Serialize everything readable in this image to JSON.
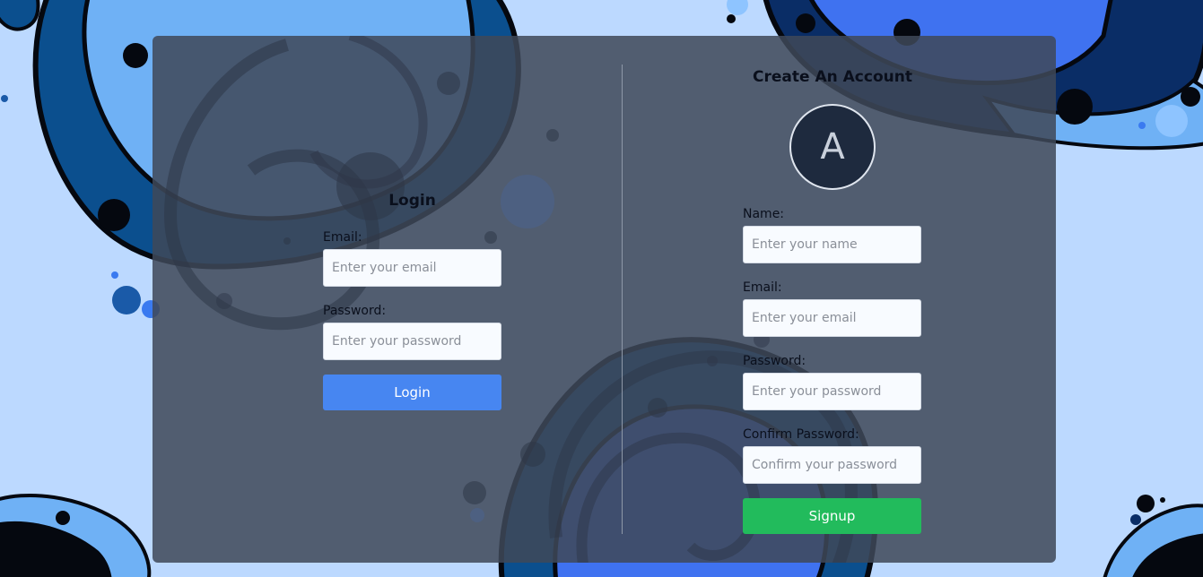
{
  "login": {
    "title": "Login",
    "email_label": "Email:",
    "email_placeholder": "Enter your email",
    "password_label": "Password:",
    "password_placeholder": "Enter your password",
    "submit_label": "Login"
  },
  "signup": {
    "title": "Create An Account",
    "avatar_letter": "A",
    "name_label": "Name:",
    "name_placeholder": "Enter your name",
    "email_label": "Email:",
    "email_placeholder": "Enter your email",
    "password_label": "Password:",
    "password_placeholder": "Enter your password",
    "confirm_label": "Confirm Password:",
    "confirm_placeholder": "Confirm your password",
    "submit_label": "Signup"
  },
  "colors": {
    "background": "#bcd9ff",
    "card": "#3f4858",
    "login_button": "#4786f1",
    "signup_button": "#22bb5c"
  }
}
